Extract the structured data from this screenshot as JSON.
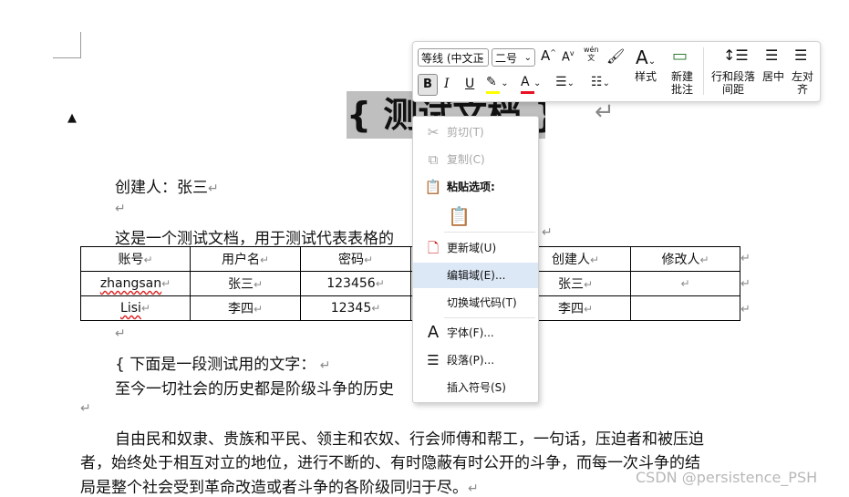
{
  "document": {
    "title_text": "{ 测试文档 }",
    "creator_label": "创建人：张三",
    "intro_text": "这是一个测试文档，用于测试代表表格的",
    "table": {
      "headers": [
        "账号",
        "用户名",
        "密码",
        "",
        "创建人",
        "修改人"
      ],
      "rows": [
        [
          "zhangsan",
          "张三",
          "123456",
          "",
          "张三",
          ""
        ],
        [
          "Lisi",
          "李四",
          "12345",
          "",
          "李四",
          ""
        ]
      ]
    },
    "section_heading": "{  下面是一段测试用的文字：",
    "history_line": "至今一切社会的历史都是阶级斗争的历史",
    "para_line1": "自由民和奴隶、贵族和平民、领主和农奴、行会师傅和帮工，一句话，压迫者和被压迫",
    "para_line2": "者，始终处于相互对立的地位，进行不断的、有时隐蔽有时公开的斗争，而每一次斗争的结",
    "para_line3": "局是整个社会受到革命改造或者斗争的各阶级同归于尽。",
    "return_mark": "↵"
  },
  "toolbar": {
    "font_name": "等线 (中文正",
    "font_size": "二号",
    "grow_font": "A",
    "shrink_font": "A",
    "phonetic": "wén",
    "bold": "B",
    "italic": "I",
    "underline": "U",
    "styles_label": "样式",
    "new_comment_label_1": "新建",
    "new_comment_label_2": "批注",
    "line_spacing_label_1": "行和段落",
    "line_spacing_label_2": "间距",
    "center_label": "居中",
    "left_align_label_1": "左对",
    "left_align_label_2": "齐",
    "highlight_color": "#ffff00",
    "font_color": "#e81123"
  },
  "context_menu": {
    "cut": "剪切(T)",
    "copy": "复制(C)",
    "paste_options": "粘贴选项:",
    "update_field": "更新域(U)",
    "edit_field": "编辑域(E)...",
    "toggle_codes": "切换域代码(T)",
    "font": "字体(F)...",
    "paragraph": "段落(P)...",
    "insert_symbol": "插入符号(S)"
  },
  "watermark": "CSDN @persistence_PSH"
}
